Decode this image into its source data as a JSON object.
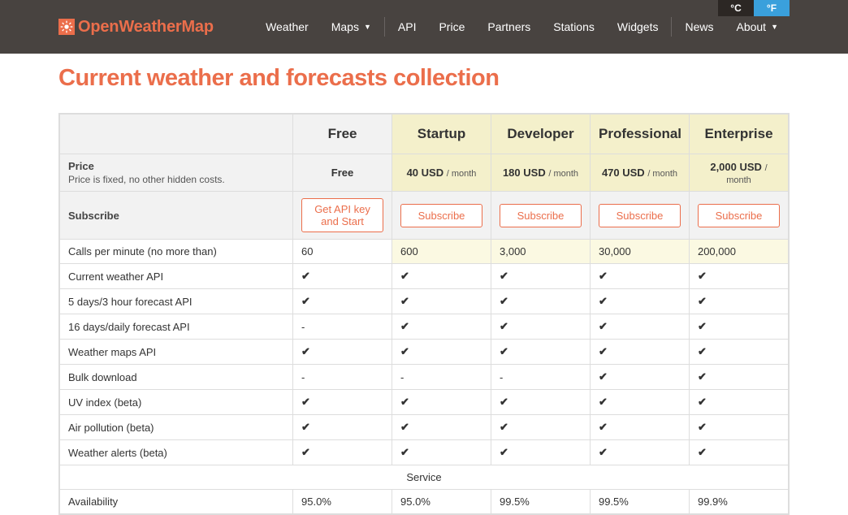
{
  "brand": {
    "name": "OpenWeatherMap"
  },
  "nav": {
    "items": [
      {
        "label": "Weather",
        "caret": false
      },
      {
        "label": "Maps",
        "caret": true
      },
      {
        "label": "API",
        "caret": false
      },
      {
        "label": "Price",
        "caret": false
      },
      {
        "label": "Partners",
        "caret": false
      },
      {
        "label": "Stations",
        "caret": false
      },
      {
        "label": "Widgets",
        "caret": false
      },
      {
        "label": "News",
        "caret": false
      },
      {
        "label": "About",
        "caret": true
      }
    ],
    "units": {
      "c": "°C",
      "f": "°F"
    }
  },
  "page": {
    "title": "Current weather and forecasts collection"
  },
  "plans": [
    {
      "name": "Free",
      "price_label": "Free",
      "permonth": "",
      "subscribe_label": "Get API key and Start",
      "highlight": false
    },
    {
      "name": "Startup",
      "price_label": "40 USD",
      "permonth": "/ month",
      "subscribe_label": "Subscribe",
      "highlight": true
    },
    {
      "name": "Developer",
      "price_label": "180 USD",
      "permonth": "/ month",
      "subscribe_label": "Subscribe",
      "highlight": true
    },
    {
      "name": "Professional",
      "price_label": "470 USD",
      "permonth": "/ month",
      "subscribe_label": "Subscribe",
      "highlight": true
    },
    {
      "name": "Enterprise",
      "price_label": "2,000 USD",
      "permonth": "/ month",
      "subscribe_label": "Subscribe",
      "highlight": true
    }
  ],
  "rows": {
    "price": {
      "label": "Price",
      "sub": "Price is fixed, no other hidden costs."
    },
    "subscribe": {
      "label": "Subscribe"
    },
    "calls": {
      "label": "Calls per minute (no more than)",
      "values": [
        "60",
        "600",
        "3,000",
        "30,000",
        "200,000"
      ]
    },
    "features": [
      {
        "label": "Current weather API",
        "values": [
          "✔",
          "✔",
          "✔",
          "✔",
          "✔"
        ]
      },
      {
        "label": "5 days/3 hour forecast API",
        "values": [
          "✔",
          "✔",
          "✔",
          "✔",
          "✔"
        ]
      },
      {
        "label": "16 days/daily forecast API",
        "values": [
          "-",
          "✔",
          "✔",
          "✔",
          "✔"
        ]
      },
      {
        "label": "Weather maps API",
        "values": [
          "✔",
          "✔",
          "✔",
          "✔",
          "✔"
        ]
      },
      {
        "label": "Bulk download",
        "values": [
          "-",
          "-",
          "-",
          "✔",
          "✔"
        ]
      },
      {
        "label": "UV index (beta)",
        "values": [
          "✔",
          "✔",
          "✔",
          "✔",
          "✔"
        ]
      },
      {
        "label": "Air pollution (beta)",
        "values": [
          "✔",
          "✔",
          "✔",
          "✔",
          "✔"
        ]
      },
      {
        "label": "Weather alerts (beta)",
        "values": [
          "✔",
          "✔",
          "✔",
          "✔",
          "✔"
        ]
      }
    ],
    "service_header": "Service",
    "availability": {
      "label": "Availability",
      "values": [
        "95.0%",
        "95.0%",
        "99.5%",
        "99.5%",
        "99.9%"
      ]
    }
  }
}
